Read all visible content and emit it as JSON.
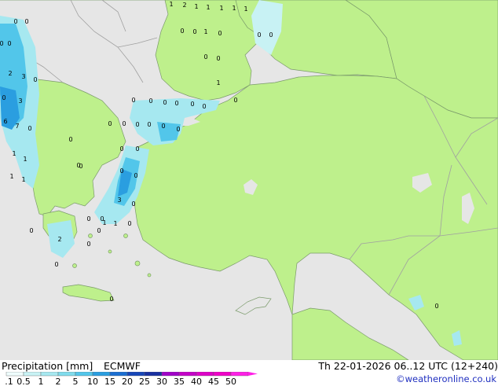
{
  "legend": {
    "title": "Precipitation [mm]",
    "model": "ECMWF",
    "ticks": [
      "0.1",
      "0.5",
      "1",
      "2",
      "5",
      "10",
      "15",
      "20",
      "25",
      "30",
      "35",
      "40",
      "45",
      "50"
    ],
    "colors": [
      "#eefcfc",
      "#c8f2f4",
      "#a6e8f0",
      "#80dcec",
      "#52c6ea",
      "#2a9ee0",
      "#1a6ed2",
      "#1646b8",
      "#1830a0",
      "#a000c8",
      "#c400c8",
      "#de00c8",
      "#f000c8",
      "#ff20e6"
    ]
  },
  "run_info": "Th 22-01-2026 06..12 UTC (12+240)",
  "credit": "©weatheronline.co.uk",
  "map": {
    "land_color": "#bef08c",
    "sea_color": "#e6e6e6",
    "border_color": "#a0a0a0",
    "precip_values": [
      "1",
      "2",
      "1",
      "1",
      "1",
      "1",
      "1",
      "0",
      "0",
      "1",
      "0",
      "0",
      "0",
      "0",
      "0",
      "0",
      "0",
      "1",
      "0",
      "0",
      "0",
      "0",
      "0",
      "0",
      "0",
      "0",
      "2",
      "3",
      "0",
      "3",
      "6",
      "7",
      "0",
      "1",
      "0",
      "1",
      "1",
      "0",
      "0",
      "0",
      "0",
      "0",
      "0",
      "0",
      "0",
      "0",
      "0",
      "0",
      "0",
      "0",
      "0",
      "0",
      "0",
      "0",
      "0",
      "3",
      "1",
      "0",
      "0",
      "0",
      "1",
      "1",
      "2",
      "0",
      "0",
      "0"
    ]
  }
}
